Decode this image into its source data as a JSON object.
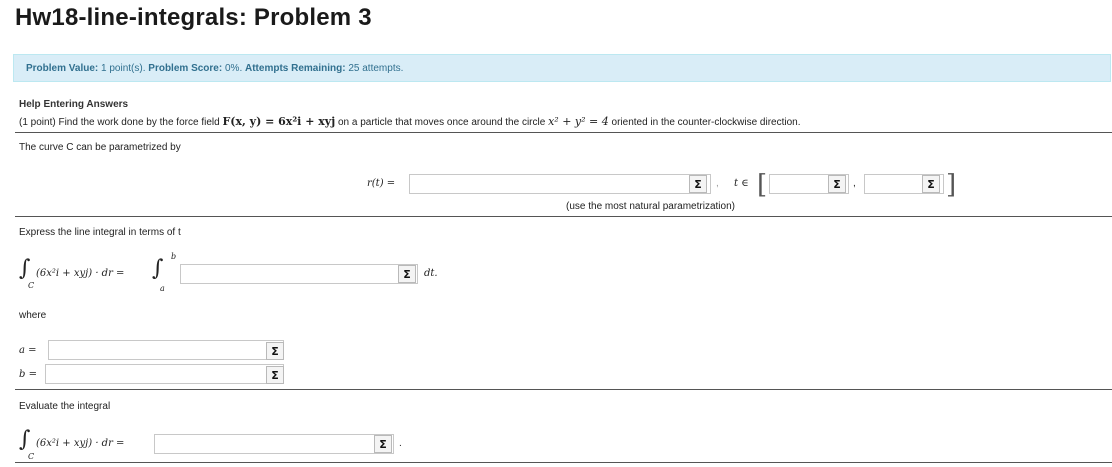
{
  "page": {
    "title": "Hw18-line-integrals: Problem 3"
  },
  "info": {
    "value_label": "Problem Value:",
    "value": "1 point(s).",
    "score_label": "Problem Score:",
    "score": "0%.",
    "attempts_label": "Attempts Remaining:",
    "attempts": "25 attempts."
  },
  "help_link": "Help Entering Answers",
  "problem": {
    "points": "(1 point) Find the work done by the force field",
    "field_expr": "F(x, y) = 6x²i + xyj",
    "mid": "on a particle that moves once around the circle",
    "circle_expr": "x² + y² = 4",
    "end": "oriented in the counter-clockwise direction."
  },
  "curve_text": "The curve C can be parametrized by",
  "param": {
    "r_label": "r(t) =",
    "t_in": "t ∈",
    "comma": ",",
    "hint": "(use the most natural parametrization)"
  },
  "express_text": "Express the line integral in terms of t",
  "line_integral": {
    "lhs": "(6x²i + xyj) · dr =",
    "upper": "b",
    "lower": "a",
    "sub": "C",
    "dt": "dt."
  },
  "where_text": "where",
  "bounds": {
    "a_label": "a =",
    "b_label": "b ="
  },
  "evaluate_text": "Evaluate the integral",
  "evaluate": {
    "lhs": "(6x²i + xyj) · dr =",
    "sub": "C",
    "end": "."
  },
  "sigma_symbol": "Σ",
  "inputs": {
    "r_value": "",
    "t_start": "",
    "t_end": "",
    "integrand": "",
    "a_value": "",
    "b_value": "",
    "result": ""
  },
  "colors": {
    "info_bg": "#d9edf7",
    "info_text": "#31708f",
    "rule": "#555555"
  }
}
